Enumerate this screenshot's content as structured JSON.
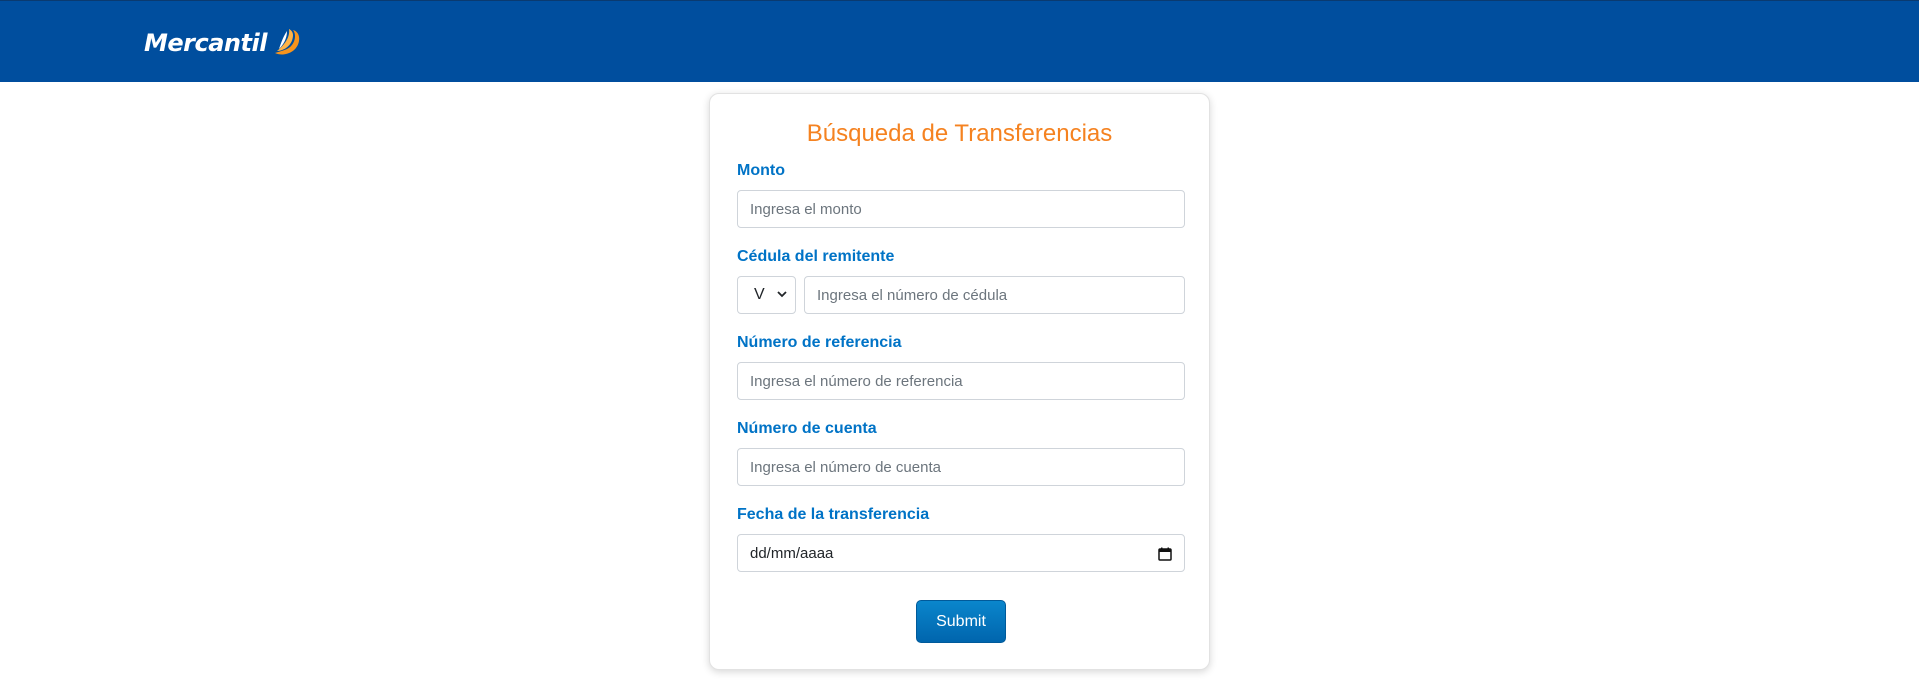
{
  "header": {
    "brand": "Mercantil",
    "colors": {
      "bar": "#004e9e",
      "accent_orange": "#f58220",
      "label_blue": "#0073c6"
    }
  },
  "form": {
    "title": "Búsqueda de Transferencias",
    "monto": {
      "label": "Monto",
      "placeholder": "Ingresa el monto"
    },
    "cedula": {
      "label": "Cédula del remitente",
      "prefix_selected": "V",
      "placeholder": "Ingresa el número de cédula"
    },
    "referencia": {
      "label": "Número de referencia",
      "placeholder": "Ingresa el número de referencia"
    },
    "cuenta": {
      "label": "Número de cuenta",
      "placeholder": "Ingresa el número de cuenta"
    },
    "fecha": {
      "label": "Fecha de la transferencia",
      "value": "dd/mm/aaaa"
    },
    "submit_label": "Submit"
  }
}
